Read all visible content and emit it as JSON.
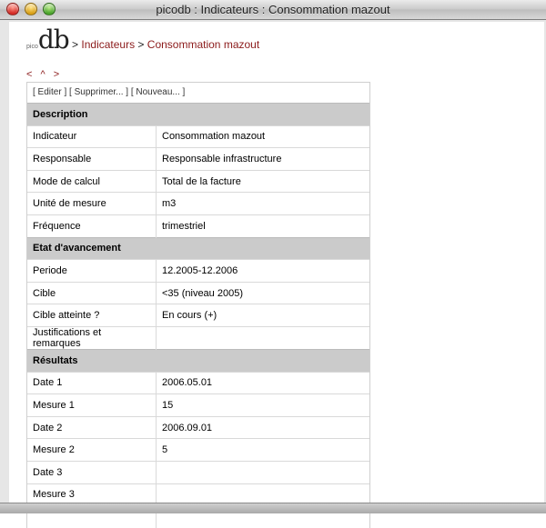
{
  "window": {
    "title": "picodb : Indicateurs : Consommation mazout"
  },
  "header": {
    "logo_small": "pico",
    "logo_big": "db",
    "sep1": " > ",
    "crumb_1": "Indicateurs",
    "sep2": " > ",
    "crumb_2": "Consommation mazout"
  },
  "nav": {
    "prev": "<",
    "up": "^",
    "next": ">"
  },
  "actions": {
    "edit": "[ Editer ]",
    "delete": "[ Supprimer... ]",
    "new": "[ Nouveau... ]"
  },
  "sections": [
    {
      "title": "Description",
      "rows": [
        {
          "label": "Indicateur",
          "value": "Consommation mazout"
        },
        {
          "label": "Responsable",
          "value": "Responsable infrastructure"
        },
        {
          "label": "Mode de calcul",
          "value": "Total de la facture"
        },
        {
          "label": "Unité de mesure",
          "value": "m3"
        },
        {
          "label": "Fréquence",
          "value": "trimestriel"
        }
      ]
    },
    {
      "title": "Etat d'avancement",
      "rows": [
        {
          "label": "Periode",
          "value": "12.2005-12.2006"
        },
        {
          "label": "Cible",
          "value": "<35 (niveau 2005)"
        },
        {
          "label": "Cible atteinte ?",
          "value": "En cours (+)"
        },
        {
          "label": "Justifications et remarques",
          "value": ""
        }
      ]
    },
    {
      "title": "Résultats",
      "rows": [
        {
          "label": "Date 1",
          "value": "2006.05.01"
        },
        {
          "label": "Mesure 1",
          "value": "15"
        },
        {
          "label": "Date 2",
          "value": "2006.09.01"
        },
        {
          "label": "Mesure 2",
          "value": "5"
        },
        {
          "label": "Date 3",
          "value": ""
        },
        {
          "label": "Mesure 3",
          "value": ""
        },
        {
          "label": "",
          "value": ""
        }
      ]
    }
  ]
}
